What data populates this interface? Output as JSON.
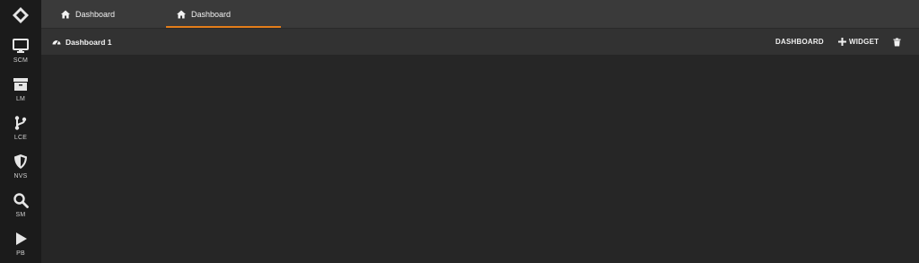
{
  "sidebar": {
    "items": [
      {
        "label": "SCM",
        "icon": "monitor-icon"
      },
      {
        "label": "LM",
        "icon": "archive-icon"
      },
      {
        "label": "LCE",
        "icon": "branch-icon"
      },
      {
        "label": "NVS",
        "icon": "shield-icon"
      },
      {
        "label": "SM",
        "icon": "search-icon"
      },
      {
        "label": "PB",
        "icon": "play-icon"
      }
    ]
  },
  "tabs": [
    {
      "label": "Dashboard",
      "icon": "home-icon",
      "active": false
    },
    {
      "label": "Dashboard",
      "icon": "home-icon",
      "active": true
    }
  ],
  "toolbar": {
    "title": "Dashboard 1",
    "dashboard_label": "DASHBOARD",
    "widget_label": "WIDGET"
  },
  "colors": {
    "accent": "#e37d1a",
    "sidebar": "#1b1b1b",
    "topbar": "#3a3a3a",
    "background": "#262626"
  }
}
